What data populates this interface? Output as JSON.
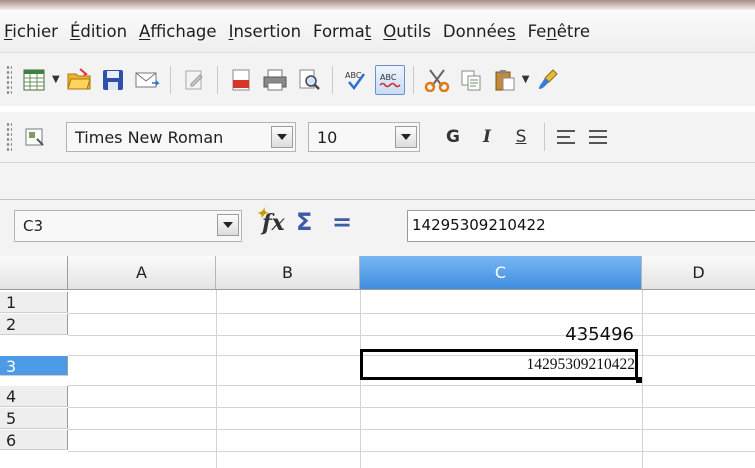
{
  "menu": [
    {
      "pre": "",
      "u": "F",
      "post": "ichier"
    },
    {
      "pre": "",
      "u": "É",
      "post": "dition"
    },
    {
      "pre": "",
      "u": "A",
      "post": "ffichage"
    },
    {
      "pre": "",
      "u": "I",
      "post": "nsertion"
    },
    {
      "pre": "Forma",
      "u": "t",
      "post": ""
    },
    {
      "pre": "",
      "u": "O",
      "post": "utils"
    },
    {
      "pre": "Donnée",
      "u": "s",
      "post": ""
    },
    {
      "pre": "Fe",
      "u": "n",
      "post": "être"
    }
  ],
  "toolbar1": {
    "icons": [
      "new-document-icon",
      "open-folder-icon",
      "save-disk-icon",
      "email-icon",
      "edit-file-icon",
      "export-pdf-icon",
      "print-icon",
      "page-preview-icon",
      "spellcheck-icon",
      "autospellcheck-icon",
      "cut-icon",
      "copy-icon",
      "paste-icon",
      "format-paintbrush-icon"
    ]
  },
  "toolbar2": {
    "font_name": "Times New Roman",
    "font_size": "10",
    "bold_label": "G",
    "italic_label": "I",
    "underline_label": "S"
  },
  "formula_bar": {
    "cell_ref": "C3",
    "formula_value": "14295309210422"
  },
  "grid": {
    "columns": [
      "A",
      "B",
      "C",
      "D"
    ],
    "selected_column": "C",
    "rows": [
      "1",
      "2",
      "3",
      "4",
      "5",
      "6"
    ],
    "selected_row": "3",
    "cells": {
      "C2": "435496",
      "C3": "14295309210422"
    }
  },
  "colors": {
    "selection_header": "#4d9be7",
    "toolbar_bg": "#f3f3f3"
  }
}
